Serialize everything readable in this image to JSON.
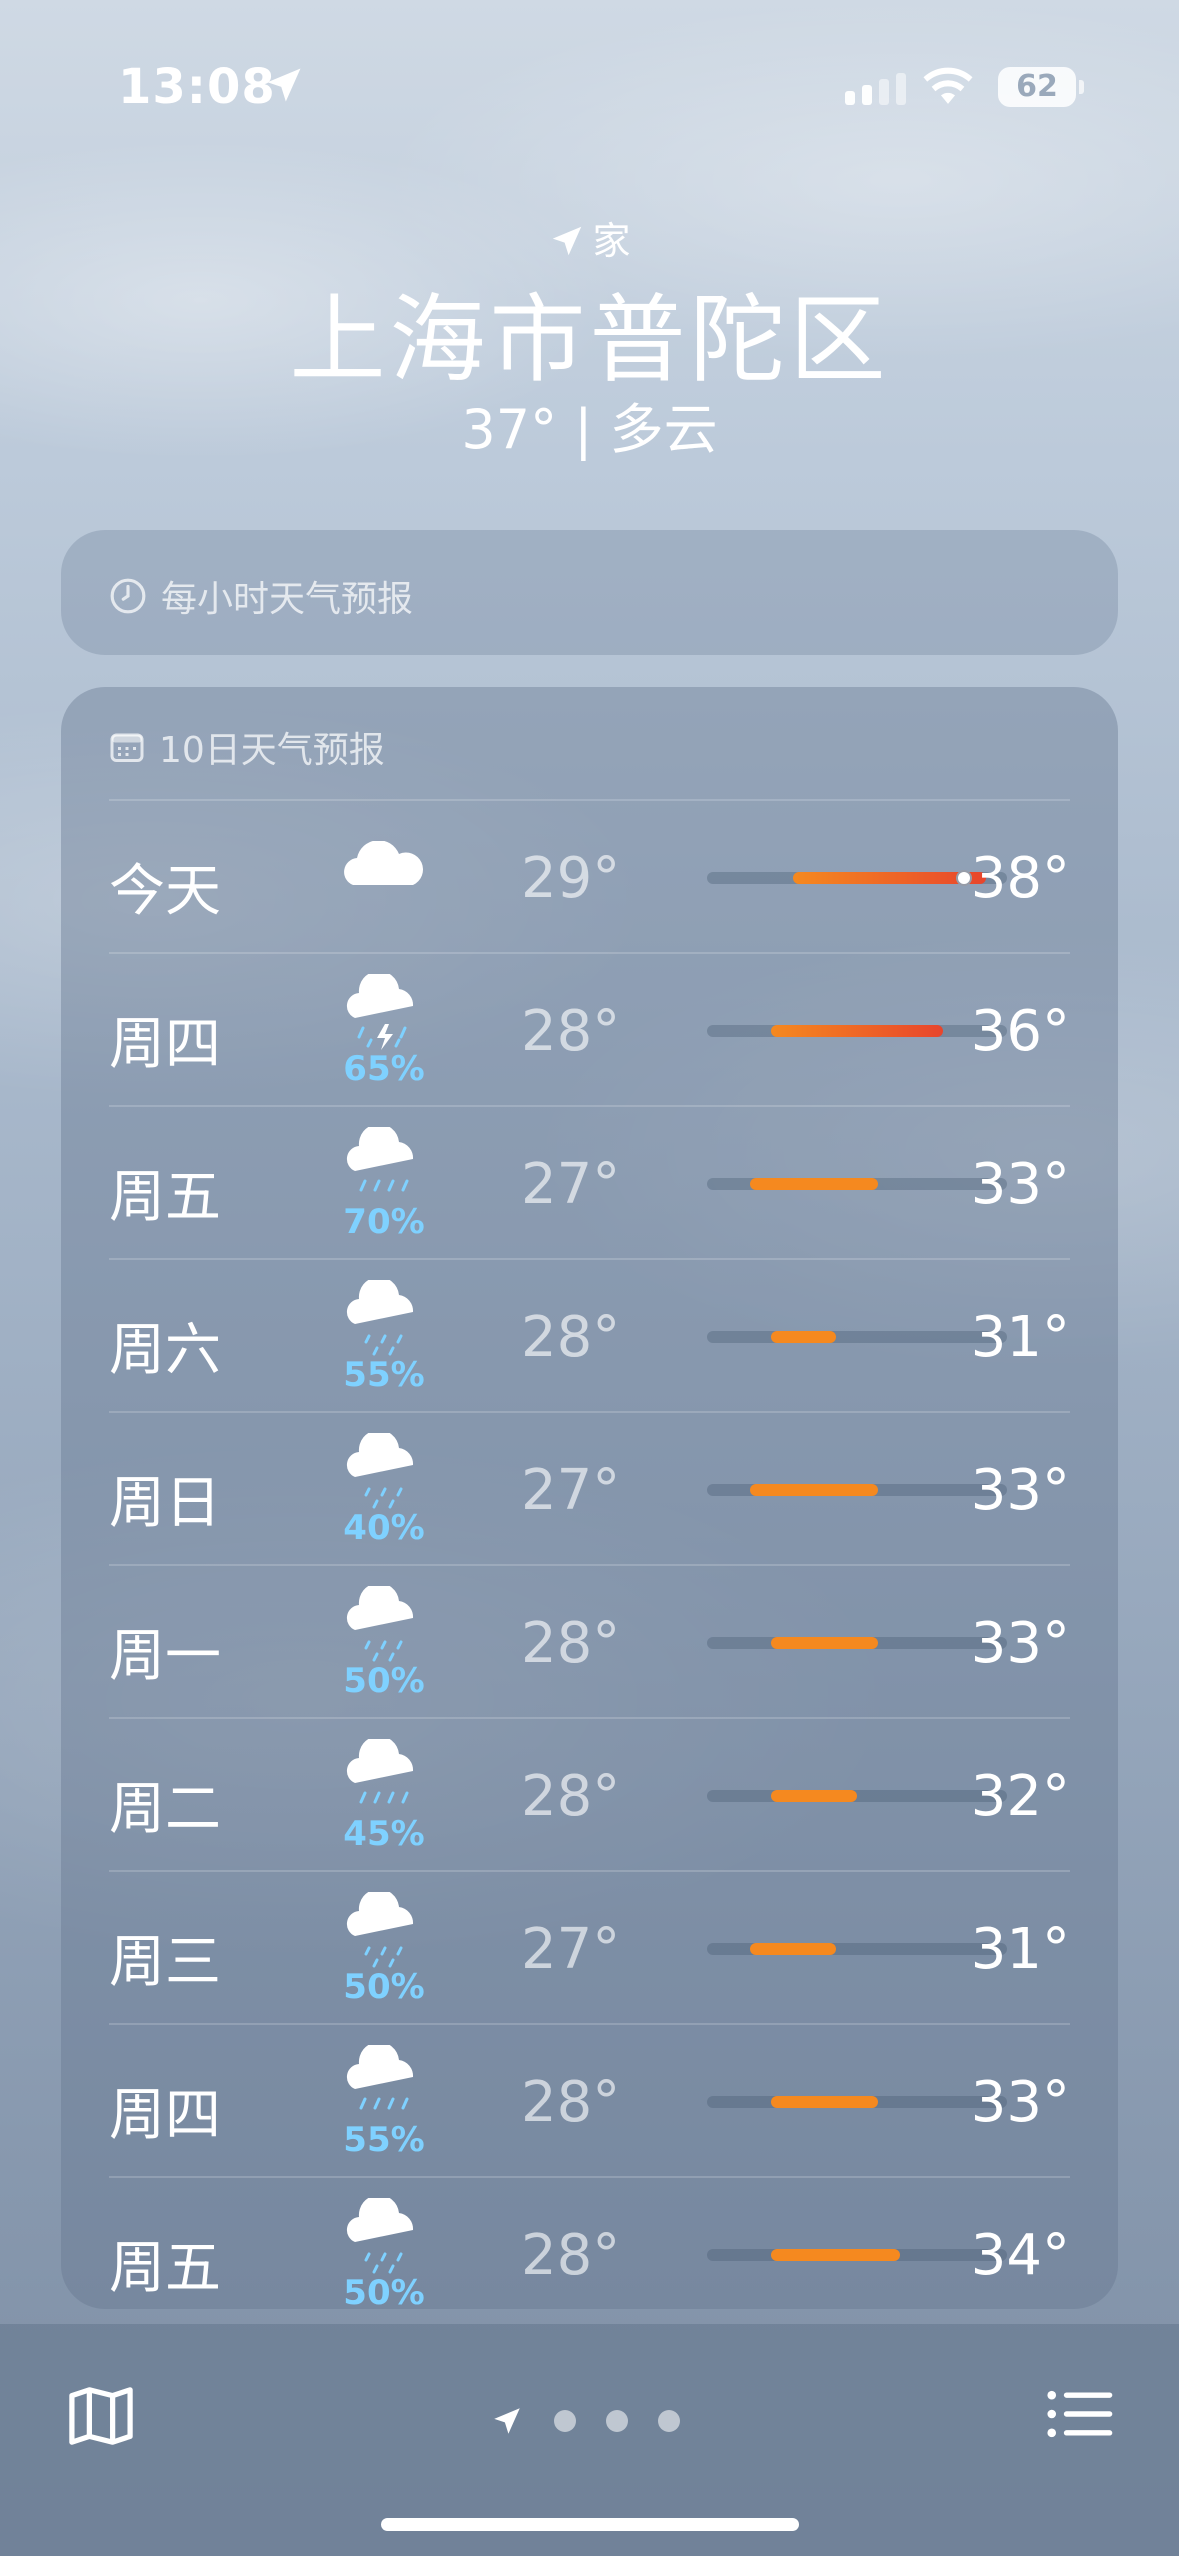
{
  "status_bar": {
    "time": "13:08",
    "battery": "62"
  },
  "header": {
    "location_tag": "家",
    "city": "上海市普陀区",
    "current": "37° | 多云"
  },
  "hourly_card": {
    "label": "每小时天气预报"
  },
  "daily_card": {
    "label": "10日天气预报",
    "days": [
      {
        "day": "今天",
        "icon": "cloud-icon",
        "precip": "",
        "low": "29°",
        "high": "38°",
        "low_val": 29,
        "high_val": 38,
        "current_val": 37
      },
      {
        "day": "周四",
        "icon": "thunderstorm-icon",
        "precip": "65%",
        "low": "28°",
        "high": "36°",
        "low_val": 28,
        "high_val": 36
      },
      {
        "day": "周五",
        "icon": "rain-icon",
        "precip": "70%",
        "low": "27°",
        "high": "33°",
        "low_val": 27,
        "high_val": 33
      },
      {
        "day": "周六",
        "icon": "drizzle-icon",
        "precip": "55%",
        "low": "28°",
        "high": "31°",
        "low_val": 28,
        "high_val": 31
      },
      {
        "day": "周日",
        "icon": "drizzle-icon",
        "precip": "40%",
        "low": "27°",
        "high": "33°",
        "low_val": 27,
        "high_val": 33
      },
      {
        "day": "周一",
        "icon": "drizzle-icon",
        "precip": "50%",
        "low": "28°",
        "high": "33°",
        "low_val": 28,
        "high_val": 33
      },
      {
        "day": "周二",
        "icon": "rain-icon",
        "precip": "45%",
        "low": "28°",
        "high": "32°",
        "low_val": 28,
        "high_val": 32
      },
      {
        "day": "周三",
        "icon": "drizzle-icon",
        "precip": "50%",
        "low": "27°",
        "high": "31°",
        "low_val": 27,
        "high_val": 31
      },
      {
        "day": "周四",
        "icon": "rain-icon",
        "precip": "55%",
        "low": "28°",
        "high": "33°",
        "low_val": 28,
        "high_val": 33
      },
      {
        "day": "周五",
        "icon": "drizzle-icon",
        "precip": "50%",
        "low": "28°",
        "high": "34°",
        "low_val": 28,
        "high_val": 34
      }
    ],
    "range_min": 25,
    "range_max": 39
  },
  "colors": {
    "precip": "#7fd1ff",
    "warm": "#f5891f",
    "hot": "#e8452c"
  }
}
